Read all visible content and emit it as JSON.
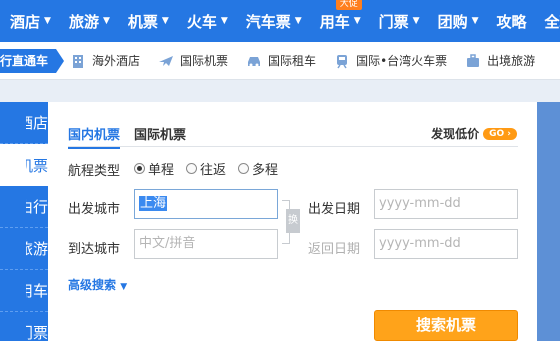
{
  "topnav": {
    "items": [
      {
        "label": "酒店"
      },
      {
        "label": "旅游"
      },
      {
        "label": "机票"
      },
      {
        "label": "火车"
      },
      {
        "label": "汽车票"
      },
      {
        "label": "用车",
        "badge": "大促"
      },
      {
        "label": "门票"
      },
      {
        "label": "团购"
      },
      {
        "label": "攻略"
      },
      {
        "label": "全球"
      }
    ]
  },
  "subnav": {
    "promo": "行直通车",
    "items": [
      {
        "label": "海外酒店",
        "icon": "building-icon"
      },
      {
        "label": "国际机票",
        "icon": "plane-icon"
      },
      {
        "label": "国际租车",
        "icon": "car-icon"
      },
      {
        "label": "国际•台湾火车票",
        "icon": "train-icon"
      },
      {
        "label": "出境旅游",
        "icon": "suitcase-icon"
      }
    ]
  },
  "sidebar": {
    "items": [
      "酒店",
      "机票",
      "自由行",
      "旅游",
      "用车",
      "门票"
    ],
    "active_index": 1
  },
  "panel": {
    "tabs": [
      "国内机票",
      "国际机票"
    ],
    "active_tab": 0,
    "discover_label": "发现低价",
    "go_label": "GO",
    "trip_type_label": "航程类型",
    "trip_types": [
      "单程",
      "往返",
      "多程"
    ],
    "selected_trip_type": 0,
    "from_label": "出发城市",
    "from_value": "上海",
    "to_label": "到达城市",
    "to_placeholder": "中文/拼音",
    "depart_label": "出发日期",
    "depart_placeholder": "yyyy-mm-dd",
    "return_label": "返回日期",
    "return_placeholder": "yyyy-mm-dd",
    "swap_label": "换",
    "advanced_label": "高级搜索",
    "search_button": "搜索机票"
  },
  "colors": {
    "brand_blue": "#2577e3",
    "accent_orange": "#ffa31a"
  }
}
